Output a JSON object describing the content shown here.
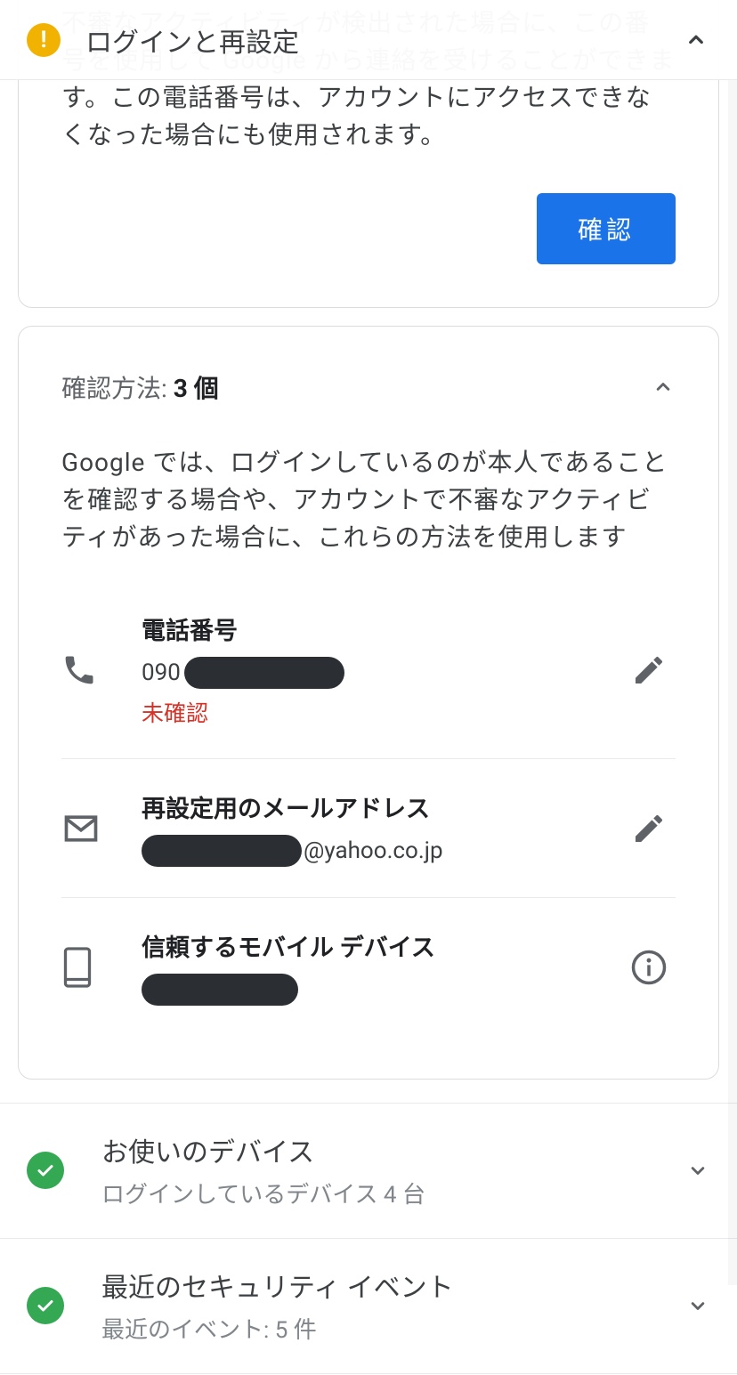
{
  "header": {
    "title": "ログインと再設定",
    "warn_glyph": "!"
  },
  "phone_notice": {
    "text": "不審なアクティビティが検出された場合に、この番号を使用して Google から連絡を受けることができます。この電話番号は、アカウントにアクセスできなくなった場合にも使用されます。",
    "confirm_label": "確認"
  },
  "verification": {
    "title_pre": "確認方法: ",
    "title_count": "3 個",
    "desc": "Google では、ログインしているのが本人であることを確認する場合や、アカウントで不審なアクティビティがあった場合に、これらの方法を使用します",
    "phone": {
      "label": "電話番号",
      "prefix": "090",
      "status": "未確認"
    },
    "email": {
      "label": "再設定用のメールアドレス",
      "domain": "@yahoo.co.jp"
    },
    "device": {
      "label": "信頼するモバイル デバイス"
    }
  },
  "sections": {
    "devices": {
      "title": "お使いのデバイス",
      "subtitle": "ログインしているデバイス 4 台"
    },
    "events": {
      "title": "最近のセキュリティ イベント",
      "subtitle": "最近のイベント: 5 件"
    }
  }
}
